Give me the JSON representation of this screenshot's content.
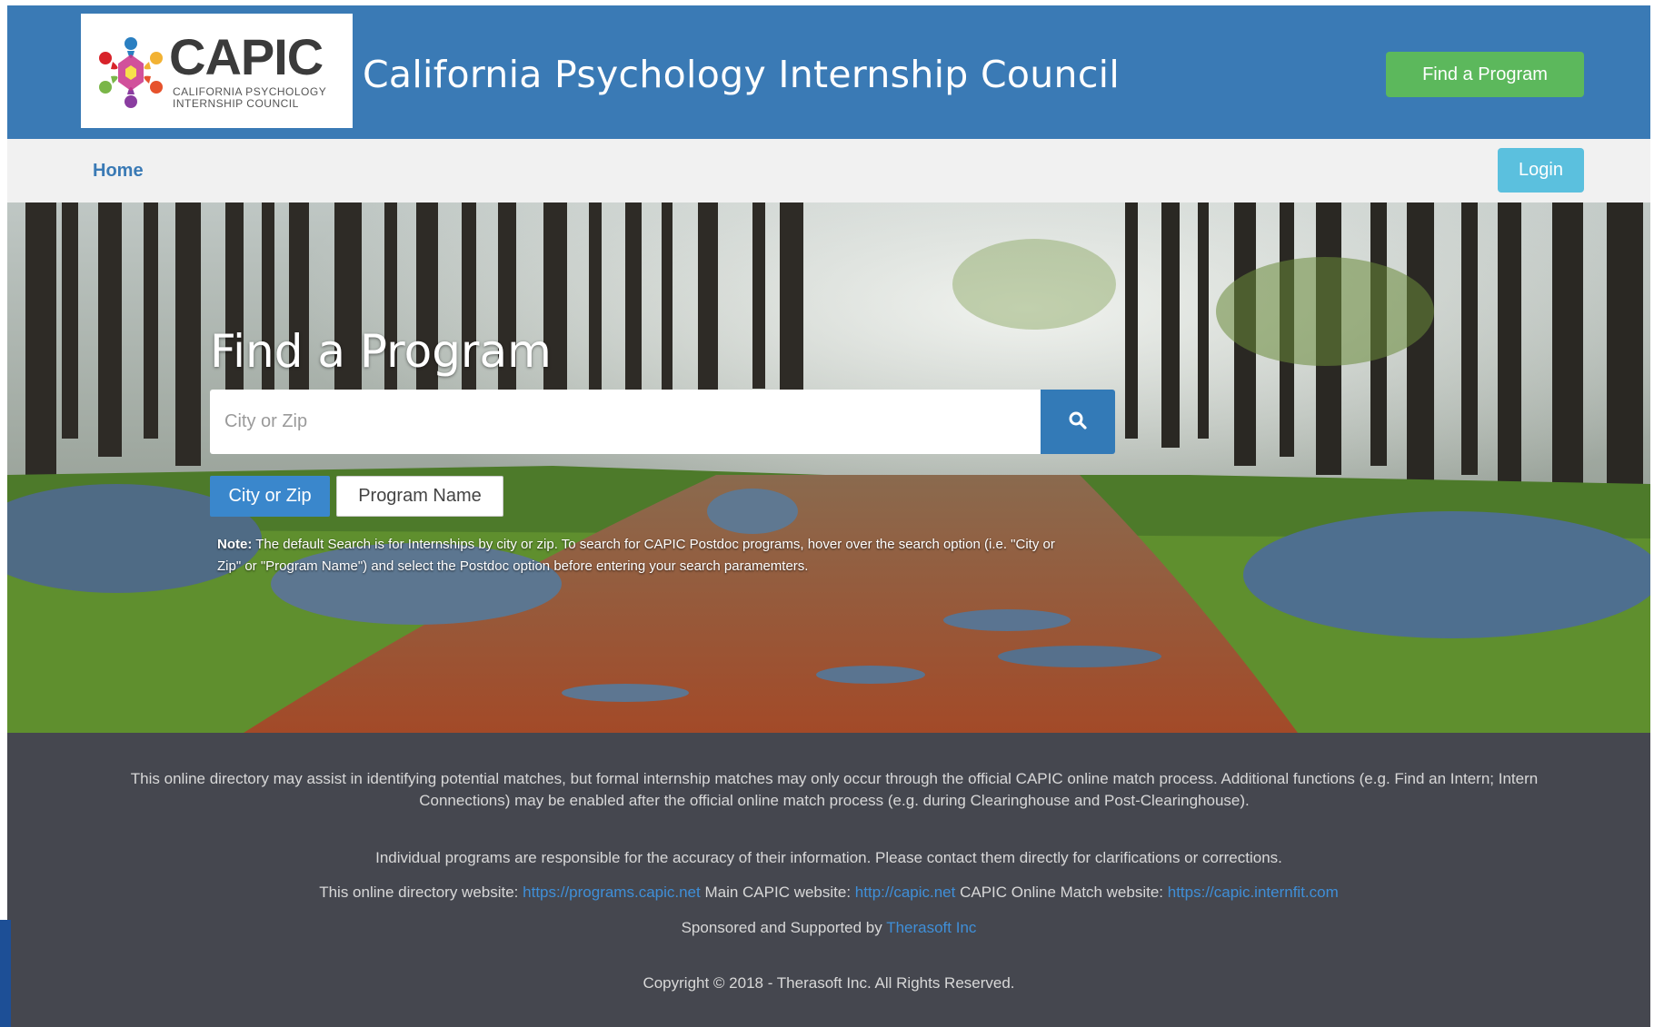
{
  "header": {
    "logo_text": "CAPIC",
    "logo_subtitle": "California Psychology Internship Council",
    "site_title": "California Psychology Internship Council",
    "find_program_button": "Find a Program"
  },
  "nav": {
    "home_label": "Home",
    "login_label": "Login"
  },
  "hero": {
    "title": "Find a Program",
    "search_placeholder": "City or Zip",
    "search_icon": "search-icon",
    "tabs": [
      {
        "label": "City or Zip",
        "active": true
      },
      {
        "label": "Program Name",
        "active": false
      }
    ],
    "note_label": "Note:",
    "note_text": " The default Search is for Internships by city or zip. To search for CAPIC Postdoc programs, hover over the search option (i.e. \"City or Zip\" or \"Program Name\") and select the Postdoc option before entering your search paramemters."
  },
  "footer": {
    "paragraph1": "This online directory may assist in identifying potential matches, but formal internship matches may only occur through the official CAPIC online match process. Additional functions (e.g. Find an Intern; Intern Connections) may be enabled after the official online match process (e.g. during Clearinghouse and Post-Clearinghouse).",
    "paragraph2": "Individual programs are responsible for the accuracy of their information. Please contact them directly for clarifications or corrections.",
    "directory_label": "This online directory website: ",
    "directory_link": "https://programs.capic.net",
    "main_label": " Main CAPIC website: ",
    "main_link": "http://capic.net",
    "match_label": " CAPIC Online Match website: ",
    "match_link": "https://capic.internfit.com",
    "sponsor_label": "Sponsored and Supported by ",
    "sponsor_link": "Therasoft Inc",
    "copyright": "Copyright © 2018 - Therasoft Inc. All Rights Reserved."
  },
  "colors": {
    "header_bg": "#3a7ab5",
    "find_button": "#5cb85c",
    "login_button": "#5bc0de",
    "search_button": "#337ab7",
    "footer_bg": "#45474f",
    "link": "#3f8fd8"
  }
}
